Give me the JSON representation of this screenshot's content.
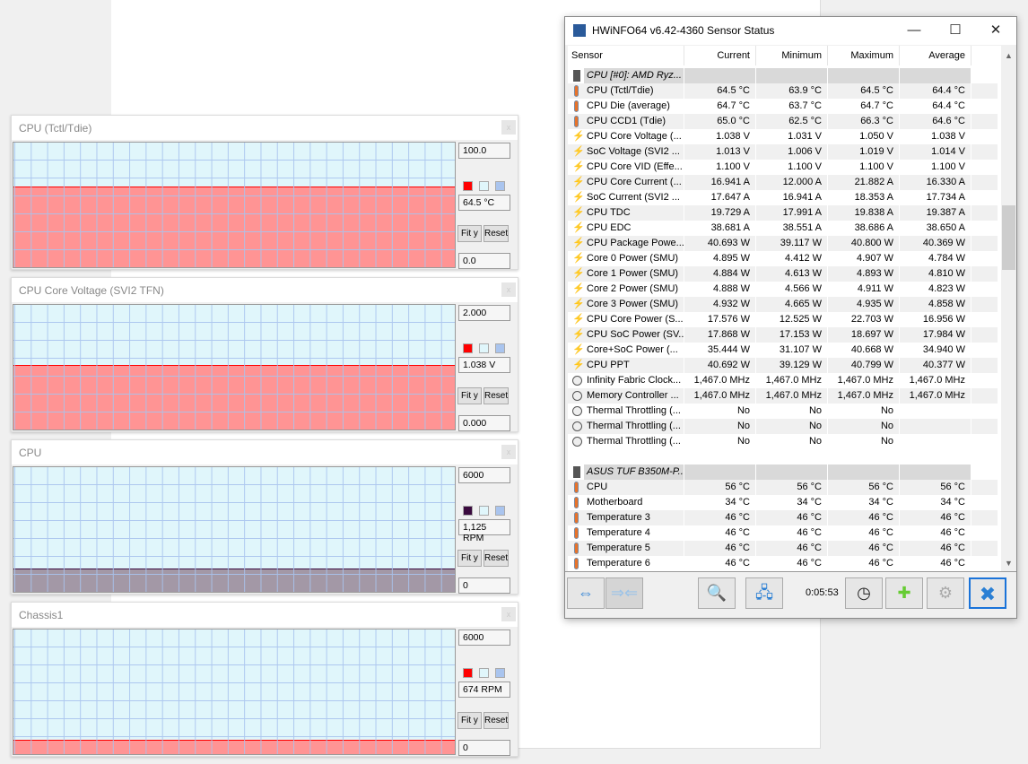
{
  "graphs": [
    {
      "title": "CPU (Tctl/Tdie)",
      "max": "100.0",
      "value": "64.5 °C",
      "min": "0.0",
      "fraction": 0.645,
      "fill": "#ff9494",
      "line": "#ff0000",
      "swatch": "#ff0000",
      "fit_label": "Fit y",
      "reset_label": "Reset"
    },
    {
      "title": "CPU Core Voltage (SVI2 TFN)",
      "max": "2.000",
      "value": "1.038 V",
      "min": "0.000",
      "fraction": 0.519,
      "fill": "#ff9494",
      "line": "#ff0000",
      "swatch": "#ff0000",
      "fit_label": "Fit y",
      "reset_label": "Reset"
    },
    {
      "title": "CPU",
      "max": "6000",
      "value": "1,125 RPM",
      "min": "0",
      "fraction": 0.1875,
      "fill": "#a398a6",
      "line": "#3a0a3e",
      "swatch": "#3a0a3e",
      "fit_label": "Fit y",
      "reset_label": "Reset"
    },
    {
      "title": "Chassis1",
      "max": "6000",
      "value": "674 RPM",
      "min": "0",
      "fraction": 0.112,
      "fill": "#ff9494",
      "line": "#ff0000",
      "swatch": "#ff0000",
      "fit_label": "Fit y",
      "reset_label": "Reset"
    }
  ],
  "hwinfo": {
    "title": "HWiNFO64 v6.42-4360 Sensor Status",
    "columns": [
      "Sensor",
      "Current",
      "Minimum",
      "Maximum",
      "Average"
    ],
    "rows": [
      {
        "type": "group",
        "icon": "chip",
        "name": "CPU [#0]: AMD Ryz..."
      },
      {
        "icon": "temp",
        "name": "CPU (Tctl/Tdie)",
        "v": [
          "64.5 °C",
          "63.9 °C",
          "64.5 °C",
          "64.4 °C"
        ]
      },
      {
        "icon": "temp",
        "name": "CPU Die (average)",
        "v": [
          "64.7 °C",
          "63.7 °C",
          "64.7 °C",
          "64.4 °C"
        ]
      },
      {
        "icon": "temp",
        "name": "CPU CCD1 (Tdie)",
        "v": [
          "65.0 °C",
          "62.5 °C",
          "66.3 °C",
          "64.6 °C"
        ]
      },
      {
        "icon": "volt",
        "name": "CPU Core Voltage (...",
        "v": [
          "1.038 V",
          "1.031 V",
          "1.050 V",
          "1.038 V"
        ]
      },
      {
        "icon": "volt",
        "name": "SoC Voltage (SVI2 ...",
        "v": [
          "1.013 V",
          "1.006 V",
          "1.019 V",
          "1.014 V"
        ]
      },
      {
        "icon": "volt",
        "name": "CPU Core VID (Effe...",
        "v": [
          "1.100 V",
          "1.100 V",
          "1.100 V",
          "1.100 V"
        ]
      },
      {
        "icon": "volt",
        "name": "CPU Core Current (...",
        "v": [
          "16.941 A",
          "12.000 A",
          "21.882 A",
          "16.330 A"
        ]
      },
      {
        "icon": "volt",
        "name": "SoC Current (SVI2 ...",
        "v": [
          "17.647 A",
          "16.941 A",
          "18.353 A",
          "17.734 A"
        ]
      },
      {
        "icon": "volt",
        "name": "CPU TDC",
        "v": [
          "19.729 A",
          "17.991 A",
          "19.838 A",
          "19.387 A"
        ]
      },
      {
        "icon": "volt",
        "name": "CPU EDC",
        "v": [
          "38.681 A",
          "38.551 A",
          "38.686 A",
          "38.650 A"
        ]
      },
      {
        "icon": "volt",
        "name": "CPU Package Powe...",
        "v": [
          "40.693 W",
          "39.117 W",
          "40.800 W",
          "40.369 W"
        ]
      },
      {
        "icon": "volt",
        "name": "Core 0 Power (SMU)",
        "v": [
          "4.895 W",
          "4.412 W",
          "4.907 W",
          "4.784 W"
        ]
      },
      {
        "icon": "volt",
        "name": "Core 1 Power (SMU)",
        "v": [
          "4.884 W",
          "4.613 W",
          "4.893 W",
          "4.810 W"
        ]
      },
      {
        "icon": "volt",
        "name": "Core 2 Power (SMU)",
        "v": [
          "4.888 W",
          "4.566 W",
          "4.911 W",
          "4.823 W"
        ]
      },
      {
        "icon": "volt",
        "name": "Core 3 Power (SMU)",
        "v": [
          "4.932 W",
          "4.665 W",
          "4.935 W",
          "4.858 W"
        ]
      },
      {
        "icon": "volt",
        "name": "CPU Core Power (S...",
        "v": [
          "17.576 W",
          "12.525 W",
          "22.703 W",
          "16.956 W"
        ]
      },
      {
        "icon": "volt",
        "name": "CPU SoC Power (SV...",
        "v": [
          "17.868 W",
          "17.153 W",
          "18.697 W",
          "17.984 W"
        ]
      },
      {
        "icon": "volt",
        "name": "Core+SoC Power (...",
        "v": [
          "35.444 W",
          "31.107 W",
          "40.668 W",
          "34.940 W"
        ]
      },
      {
        "icon": "volt",
        "name": "CPU PPT",
        "v": [
          "40.692 W",
          "39.129 W",
          "40.799 W",
          "40.377 W"
        ]
      },
      {
        "icon": "clock",
        "name": "Infinity Fabric Clock...",
        "v": [
          "1,467.0 MHz",
          "1,467.0 MHz",
          "1,467.0 MHz",
          "1,467.0 MHz"
        ]
      },
      {
        "icon": "clock",
        "name": "Memory Controller ...",
        "v": [
          "1,467.0 MHz",
          "1,467.0 MHz",
          "1,467.0 MHz",
          "1,467.0 MHz"
        ]
      },
      {
        "icon": "clock",
        "name": "Thermal Throttling (...",
        "v": [
          "No",
          "No",
          "No",
          ""
        ]
      },
      {
        "icon": "clock",
        "name": "Thermal Throttling (...",
        "v": [
          "No",
          "No",
          "No",
          ""
        ]
      },
      {
        "icon": "clock",
        "name": "Thermal Throttling (...",
        "v": [
          "No",
          "No",
          "No",
          ""
        ]
      },
      {
        "type": "blank"
      },
      {
        "type": "group",
        "icon": "chip",
        "name": "ASUS TUF B350M-P..."
      },
      {
        "icon": "temp",
        "name": "CPU",
        "v": [
          "56 °C",
          "56 °C",
          "56 °C",
          "56 °C"
        ]
      },
      {
        "icon": "temp",
        "name": "Motherboard",
        "v": [
          "34 °C",
          "34 °C",
          "34 °C",
          "34 °C"
        ]
      },
      {
        "icon": "temp",
        "name": "Temperature 3",
        "v": [
          "46 °C",
          "46 °C",
          "46 °C",
          "46 °C"
        ]
      },
      {
        "icon": "temp",
        "name": "Temperature 4",
        "v": [
          "46 °C",
          "46 °C",
          "46 °C",
          "46 °C"
        ]
      },
      {
        "icon": "temp",
        "name": "Temperature 5",
        "v": [
          "46 °C",
          "46 °C",
          "46 °C",
          "46 °C"
        ]
      },
      {
        "icon": "temp",
        "name": "Temperature 6",
        "v": [
          "46 °C",
          "46 °C",
          "46 °C",
          "46 °C"
        ]
      }
    ],
    "timer": "0:05:53"
  }
}
